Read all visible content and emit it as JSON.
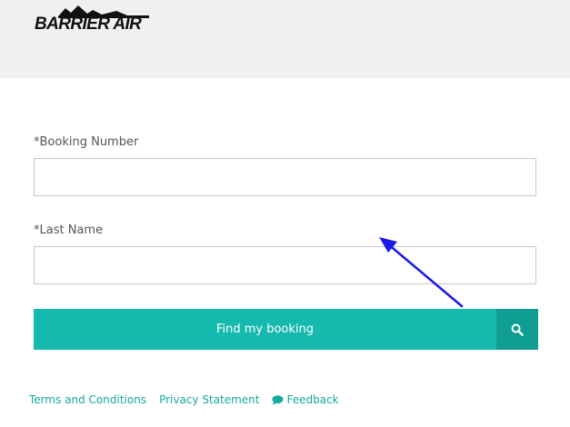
{
  "header": {
    "logo_text": "BARRIER AIR"
  },
  "form": {
    "booking_number_label": "*Booking Number",
    "booking_number_value": "",
    "last_name_label": "*Last Name",
    "last_name_value": "",
    "find_button_label": "Find my booking",
    "search_icon": "search-icon"
  },
  "footer": {
    "terms_label": "Terms and Conditions",
    "privacy_label": "Privacy Statement",
    "feedback_label": "Feedback",
    "feedback_icon": "speech-bubble-icon"
  },
  "colors": {
    "accent": "#15b9ae",
    "accent_dark": "#109e93",
    "header_bg": "#f0f0f0",
    "annotation_arrow": "#1a1ae6"
  }
}
